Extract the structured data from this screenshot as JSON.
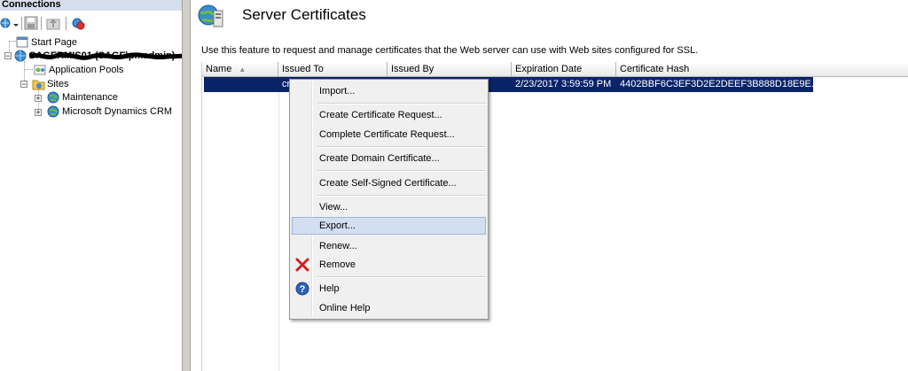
{
  "connections": {
    "header": "Connections",
    "tree": [
      {
        "label": "Start Page"
      },
      {
        "label": "SAGERMIS01 (SAGE\\pmadmin)",
        "redacted": true
      },
      {
        "label": "Application Pools"
      },
      {
        "label": "Sites"
      },
      {
        "label": "Maintenance"
      },
      {
        "label": "Microsoft Dynamics CRM"
      }
    ],
    "expanders": {
      "server": "−",
      "sites": "−",
      "maintenance": "+",
      "crm": "+"
    }
  },
  "main": {
    "title": "Server Certificates",
    "description": "Use this feature to request and manage certificates that the Web server can use with Web sites configured for SSL.",
    "columns": [
      "Name",
      "Issued To",
      "Issued By",
      "Expiration Date",
      "Certificate Hash"
    ],
    "sort_indicator": "▲",
    "rows": [
      {
        "name": "",
        "issued_to": "cr",
        "issued_by": "",
        "expiration": "2/23/2017 3:59:59 PM",
        "hash": "4402BBF6C3EF3D2E2DEEF3B888D18E9E..."
      }
    ]
  },
  "context_menu": {
    "items": [
      {
        "label": "Import...",
        "icon": ""
      },
      {
        "label": "Create Certificate Request...",
        "icon": ""
      },
      {
        "label": "Complete Certificate Request...",
        "icon": ""
      },
      {
        "label": "Create Domain Certificate...",
        "icon": ""
      },
      {
        "label": "Create Self-Signed Certificate...",
        "icon": ""
      },
      {
        "label": "View...",
        "icon": ""
      },
      {
        "label": "Export...",
        "icon": "",
        "highlighted": true
      },
      {
        "label": "Renew...",
        "icon": ""
      },
      {
        "label": "Remove",
        "icon": "red-x-icon"
      },
      {
        "label": "Help",
        "icon": "help-icon"
      },
      {
        "label": "Online Help",
        "icon": ""
      }
    ]
  },
  "colors": {
    "selection": "#0a246a",
    "menu_highlight": "#d3def0",
    "panel_header": "#d6dfec",
    "splitter": "#d4d0c8"
  }
}
